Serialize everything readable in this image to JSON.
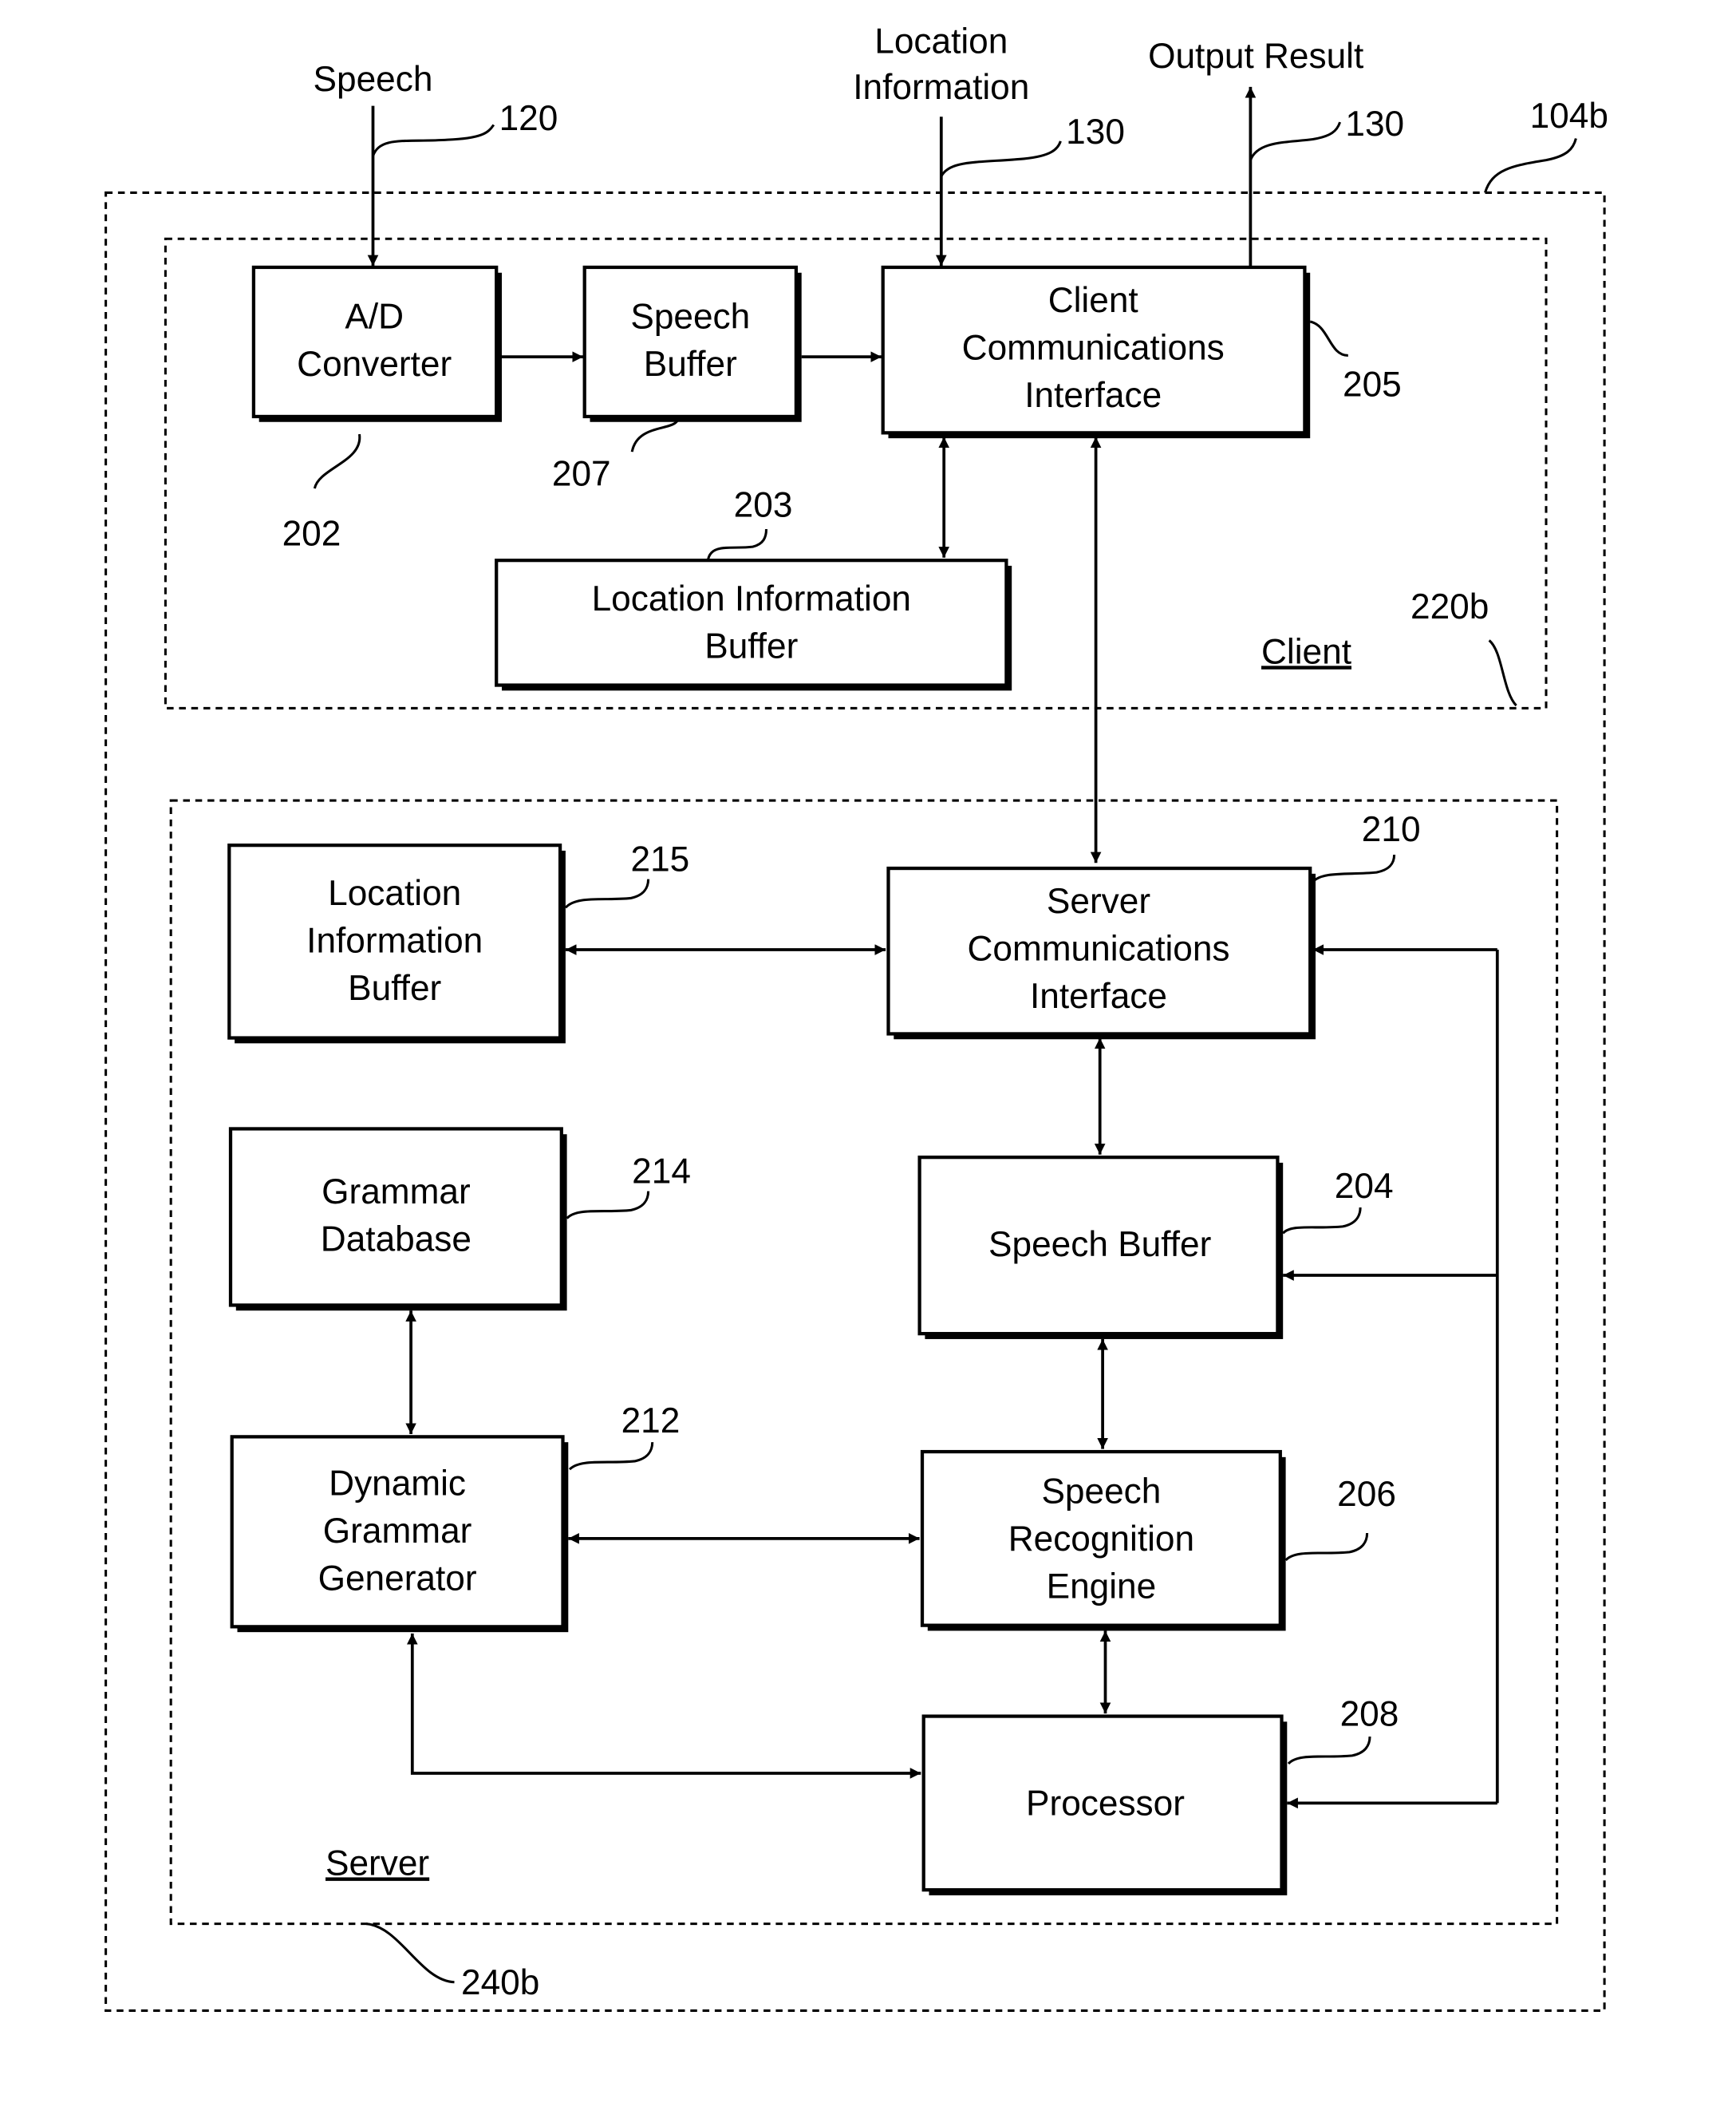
{
  "figure": {
    "outer_ref": "104b",
    "client_region": {
      "label": "Client",
      "ref": "220b"
    },
    "server_region": {
      "label": "Server",
      "ref": "240b"
    },
    "external_inputs": {
      "speech": {
        "label": "Speech",
        "ref": "120"
      },
      "location": {
        "label_line1": "Location",
        "label_line2": "Information",
        "ref": "130"
      },
      "output": {
        "label": "Output Result",
        "ref": "130"
      }
    },
    "blocks": {
      "ad_converter": {
        "lines": [
          "A/D",
          "Converter"
        ],
        "ref": "202"
      },
      "client_speech_buffer": {
        "lines": [
          "Speech",
          "Buffer"
        ],
        "ref": "207"
      },
      "client_comm": {
        "lines": [
          "Client",
          "Communications",
          "Interface"
        ],
        "ref": "205"
      },
      "client_loc_buffer": {
        "lines": [
          "Location Information",
          "Buffer"
        ],
        "ref": "203"
      },
      "server_loc_buffer": {
        "lines": [
          "Location",
          "Information",
          "Buffer"
        ],
        "ref": "215"
      },
      "server_comm": {
        "lines": [
          "Server",
          "Communications",
          "Interface"
        ],
        "ref": "210"
      },
      "grammar_db": {
        "lines": [
          "Grammar",
          "Database"
        ],
        "ref": "214"
      },
      "server_speech_buffer": {
        "lines": [
          "Speech Buffer"
        ],
        "ref": "204"
      },
      "dyn_grammar": {
        "lines": [
          "Dynamic",
          "Grammar",
          "Generator"
        ],
        "ref": "212"
      },
      "sre": {
        "lines": [
          "Speech",
          "Recognition",
          "Engine"
        ],
        "ref": "206"
      },
      "processor": {
        "lines": [
          "Processor"
        ],
        "ref": "208"
      }
    },
    "connections": [
      {
        "from": "Speech",
        "to": "A/D Converter",
        "type": "one-way"
      },
      {
        "from": "A/D Converter",
        "to": "Speech Buffer",
        "type": "one-way"
      },
      {
        "from": "Speech Buffer",
        "to": "Client Communications Interface",
        "type": "one-way"
      },
      {
        "from": "Location Information",
        "to": "Client Communications Interface",
        "type": "one-way"
      },
      {
        "from": "Client Communications Interface",
        "to": "Output Result",
        "type": "one-way"
      },
      {
        "from": "Client Communications Interface",
        "to": "Location Information Buffer (203)",
        "type": "two-way"
      },
      {
        "from": "Client Communications Interface",
        "to": "Server Communications Interface",
        "type": "two-way"
      },
      {
        "from": "Location Information Buffer (215)",
        "to": "Server Communications Interface",
        "type": "two-way"
      },
      {
        "from": "Server Communications Interface",
        "to": "Speech Buffer (204)",
        "type": "two-way"
      },
      {
        "from": "Grammar Database",
        "to": "Dynamic Grammar Generator",
        "type": "two-way"
      },
      {
        "from": "Speech Buffer (204)",
        "to": "Speech Recognition Engine",
        "type": "two-way"
      },
      {
        "from": "Dynamic Grammar Generator",
        "to": "Speech Recognition Engine",
        "type": "two-way"
      },
      {
        "from": "Speech Recognition Engine",
        "to": "Processor",
        "type": "two-way"
      },
      {
        "from": "Dynamic Grammar Generator",
        "to": "Processor",
        "type": "two-way"
      },
      {
        "from": "Processor bus",
        "to": [
          "Server Communications Interface",
          "Speech Buffer (204)",
          "Processor"
        ],
        "type": "feedback"
      }
    ]
  }
}
